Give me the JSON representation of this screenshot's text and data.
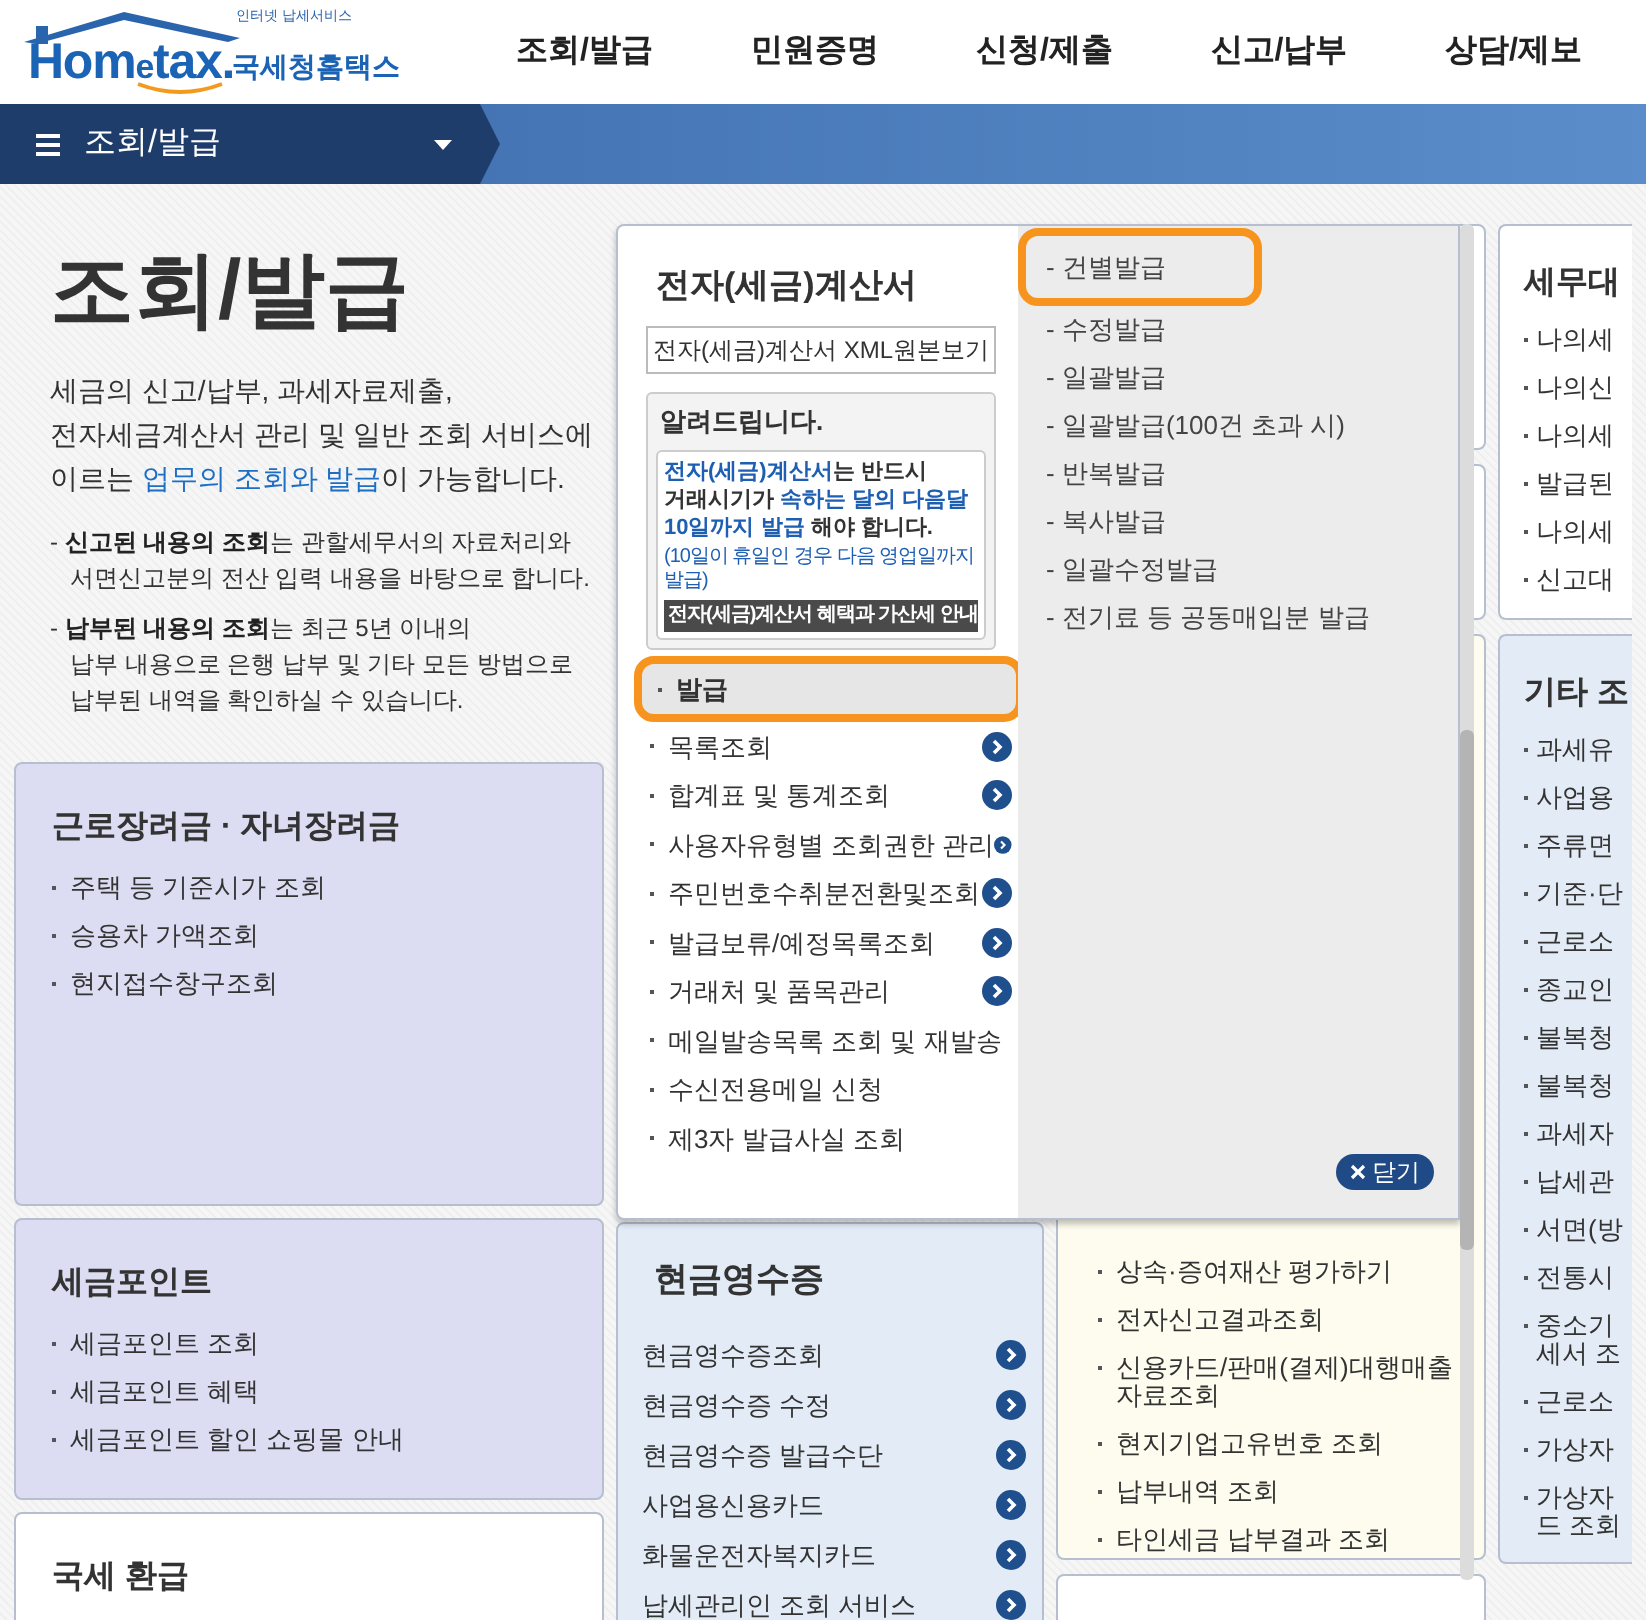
{
  "header": {
    "logo": {
      "tagline": "인터넷 납세서비스",
      "wordmark": [
        {
          "text": "Hom",
          "kind": "main"
        },
        {
          "text": "e",
          "kind": "accent"
        },
        {
          "text": "tax.",
          "kind": "main"
        }
      ],
      "name": "국세청홈택스"
    },
    "nav": [
      {
        "label": "조회/발급"
      },
      {
        "label": "민원증명"
      },
      {
        "label": "신청/제출"
      },
      {
        "label": "신고/납부"
      },
      {
        "label": "상담/제보"
      }
    ]
  },
  "menu_bar": {
    "label": "조회/발급"
  },
  "intro": {
    "title": "조회/발급",
    "description": [
      {
        "text": "세금의 신고/납부, 과세자료제출,\n전자세금계산서 관리 및 일반 조회 서비스에\n이르는 ",
        "emphasis": false
      },
      {
        "text": "업무의 조회와 발급",
        "emphasis": true
      },
      {
        "text": "이 가능합니다.",
        "emphasis": false
      }
    ],
    "notes": [
      "- **신고된 내용의 조회**는 관할세무서의 자료처리와\n서면신고분의 전산 입력 내용을 바탕으로 합니다.",
      "- **납부된 내용의 조회**는 최근 5년 이내의\n납부 내용으로 은행 납부 및 기타 모든 방법으로\n납부된 내역을 확인하실 수 있습니다."
    ]
  },
  "left_cards": [
    {
      "title": "근로장려금 · 자녀장려금",
      "color": "#dcdcf2",
      "items": [
        "주택 등 기준시가 조회",
        "승용차 가액조회",
        "현지접수창구조회"
      ]
    },
    {
      "title": "세금포인트",
      "color": "#dcdcf2",
      "items": [
        "세금포인트 조회",
        "세금포인트 혜택",
        "세금포인트 할인 쇼핑몰 안내"
      ]
    },
    {
      "title": "국세 환급",
      "color": "#ffffff"
    }
  ],
  "popup": {
    "title": "전자(세금)계산서",
    "xml_button": "전자(세금)계산서 XML원본보기",
    "notice": {
      "heading": "알려드립니다.",
      "text": "**전자(세금)계산서**는 반드시\n거래시기가 **속하는 달의 다음달\n10일까지 발급** 해야 합니다.",
      "note": "(10일이 휴일인 경우 다음 영업일까지 발급)",
      "link": "전자(세금)계산서 혜택과 가산세 안내"
    },
    "items": [
      {
        "label": "발급",
        "selected": true,
        "highlighted": true,
        "expandable": false
      },
      {
        "label": "목록조회",
        "selected": false,
        "highlighted": false,
        "expandable": true
      },
      {
        "label": "합계표 및 통계조회",
        "selected": false,
        "highlighted": false,
        "expandable": true
      },
      {
        "label": "사용자유형별 조회권한 관리",
        "selected": false,
        "highlighted": false,
        "expandable": true
      },
      {
        "label": "주민번호수취분전환및조회",
        "selected": false,
        "highlighted": false,
        "expandable": true
      },
      {
        "label": "발급보류/예정목록조회",
        "selected": false,
        "highlighted": false,
        "expandable": true
      },
      {
        "label": "거래처 및 품목관리",
        "selected": false,
        "highlighted": false,
        "expandable": true
      },
      {
        "label": "메일발송목록 조회 및 재발송",
        "selected": false,
        "highlighted": false,
        "expandable": false
      },
      {
        "label": "수신전용메일 신청",
        "selected": false,
        "highlighted": false,
        "expandable": false
      },
      {
        "label": "제3자 발급사실 조회",
        "selected": false,
        "highlighted": false,
        "expandable": false
      }
    ],
    "submenu": [
      {
        "label": "- 건별발급",
        "highlighted": true
      },
      {
        "label": "- 수정발급",
        "highlighted": false
      },
      {
        "label": "- 일괄발급",
        "highlighted": false
      },
      {
        "label": "- 일괄발급(100건 초과 시)",
        "highlighted": false
      },
      {
        "label": "- 반복발급",
        "highlighted": false
      },
      {
        "label": "- 복사발급",
        "highlighted": false
      },
      {
        "label": "- 일괄수정발급",
        "highlighted": false
      },
      {
        "label": "- 전기료 등 공동매입분 발급",
        "highlighted": false
      }
    ],
    "close_button": "닫기"
  },
  "cash_receipt": {
    "title": "현금영수증",
    "items": [
      "현금영수증조회",
      "현금영수증 수정",
      "현금영수증 발급수단",
      "사업용신용카드",
      "화물운전자복지카드",
      "납세관리인 조회 서비스"
    ]
  },
  "inquiry_card": {
    "items": [
      "상속·증여재산 평가하기",
      "전자신고결과조회",
      "신용카드/판매(결제)대행매출 자료조회",
      "현지기업고유번호 조회",
      "납부내역 조회",
      "타인세금 납부결과 조회"
    ]
  },
  "right_cards": [
    {
      "title": "세무대",
      "color": "#ffffff",
      "items": [
        [
          "나의세"
        ],
        [
          "나의신"
        ],
        [
          "나의세"
        ],
        [
          "발급된"
        ],
        [
          "나의세"
        ],
        [
          "신고대"
        ]
      ]
    },
    {
      "title": "기타 조",
      "color": "#e3ecf6",
      "items": [
        [
          "과세유"
        ],
        [
          "사업용"
        ],
        [
          "주류면"
        ],
        [
          "기준·단"
        ],
        [
          "근로소"
        ],
        [
          "종교인"
        ],
        [
          "불복청"
        ],
        [
          "불복청"
        ],
        [
          "과세자"
        ],
        [
          "납세관"
        ],
        [
          "서면(방"
        ],
        [
          "전통시"
        ],
        [
          "중소기",
          "세서 조"
        ],
        [
          "근로소"
        ],
        [
          "가상자"
        ],
        [
          "가상자",
          "드 조회"
        ]
      ]
    }
  ]
}
